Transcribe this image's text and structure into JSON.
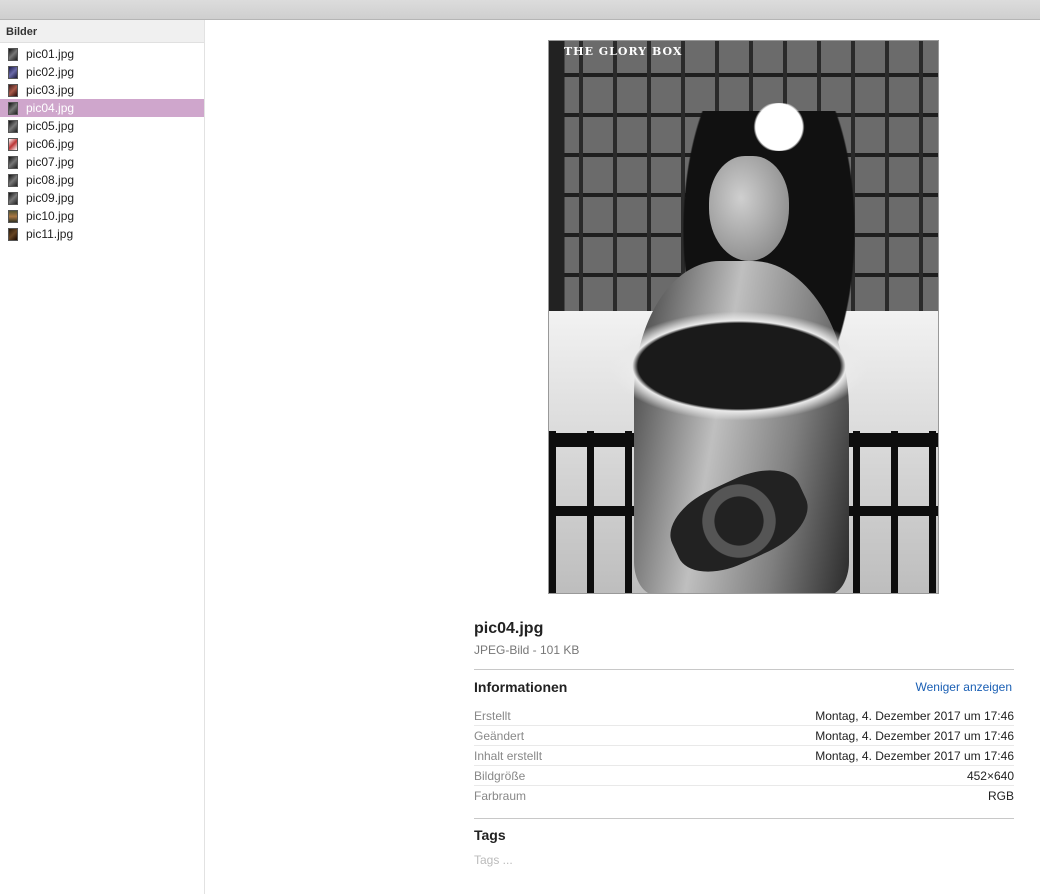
{
  "sidebar": {
    "header": "Bilder",
    "files": [
      {
        "name": "pic01.jpg",
        "thumb": "t1"
      },
      {
        "name": "pic02.jpg",
        "thumb": "t2"
      },
      {
        "name": "pic03.jpg",
        "thumb": "t3"
      },
      {
        "name": "pic04.jpg",
        "thumb": "t4"
      },
      {
        "name": "pic05.jpg",
        "thumb": "t5"
      },
      {
        "name": "pic06.jpg",
        "thumb": "t6"
      },
      {
        "name": "pic07.jpg",
        "thumb": "t7"
      },
      {
        "name": "pic08.jpg",
        "thumb": "t8"
      },
      {
        "name": "pic09.jpg",
        "thumb": "t9"
      },
      {
        "name": "pic10.jpg",
        "thumb": "t10"
      },
      {
        "name": "pic11.jpg",
        "thumb": "t11"
      }
    ],
    "selected_index": 3,
    "selection_color": "#cfa6cc"
  },
  "preview": {
    "caption": "THE GLORY BOX"
  },
  "info": {
    "file_name": "pic04.jpg",
    "file_type": "JPEG-Bild - 101 KB",
    "section_title": "Informationen",
    "toggle_label": "Weniger anzeigen",
    "rows": [
      {
        "key": "Erstellt",
        "value": "Montag, 4. Dezember 2017 um 17:46"
      },
      {
        "key": "Geändert",
        "value": "Montag, 4. Dezember 2017 um 17:46"
      },
      {
        "key": "Inhalt erstellt",
        "value": "Montag, 4. Dezember 2017 um 17:46"
      },
      {
        "key": "Bildgröße",
        "value": "452×640"
      },
      {
        "key": "Farbraum",
        "value": "RGB"
      }
    ],
    "tags_title": "Tags",
    "tags_placeholder": "Tags ...",
    "link_color": "#1a5fb4"
  }
}
